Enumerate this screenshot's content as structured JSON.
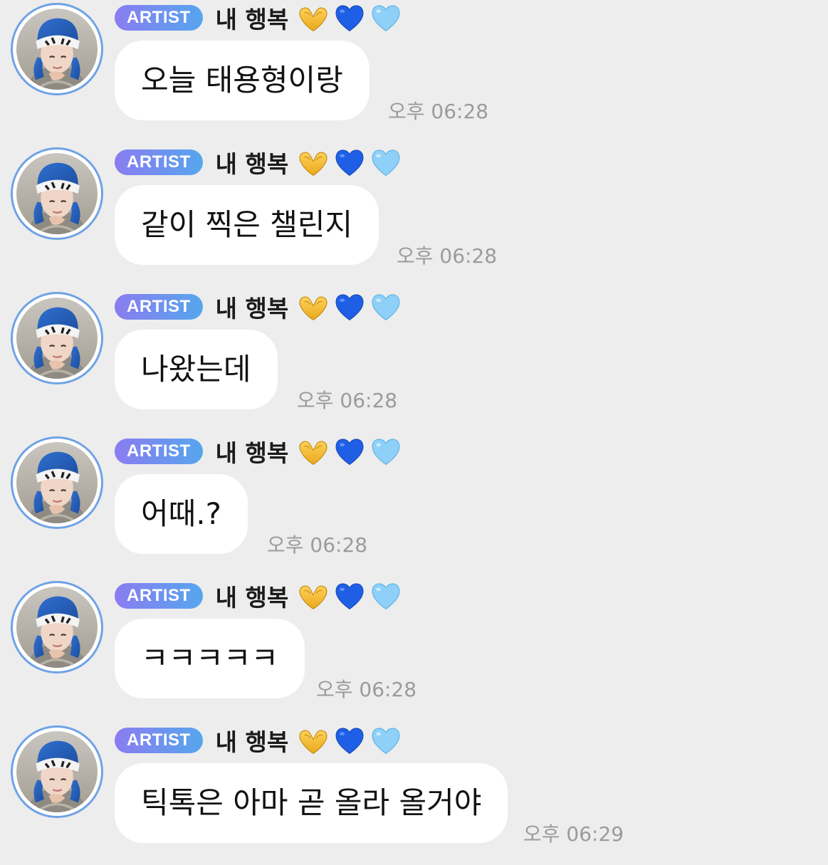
{
  "badge": {
    "label": "ARTIST",
    "gradient_start": "#8a7cf0",
    "gradient_end": "#56a6ee"
  },
  "sender": {
    "name": "내 행복",
    "emojis": [
      "heart-hands-emoji",
      "blue-heart-emoji",
      "light-blue-heart-emoji"
    ]
  },
  "colors": {
    "background": "#ededed",
    "bubble": "#ffffff",
    "avatar_ring": "#6fa2e6",
    "time_text": "#9b9b9b"
  },
  "messages": [
    {
      "text": "오늘 태용형이랑",
      "time": "오후 06:28"
    },
    {
      "text": "같이 찍은 챌린지",
      "time": "오후 06:28"
    },
    {
      "text": "나왔는데",
      "time": "오후 06:28"
    },
    {
      "text": "어때.?",
      "time": "오후 06:28"
    },
    {
      "text": "ㅋㅋㅋㅋㅋ",
      "time": "오후 06:28"
    },
    {
      "text": "틱톡은 아마 곧 올라 올거야",
      "time": "오후 06:29"
    }
  ]
}
